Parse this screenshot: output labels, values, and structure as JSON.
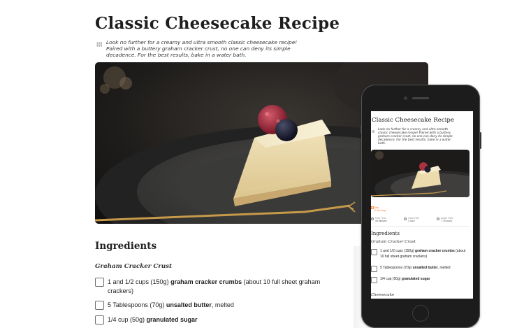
{
  "recipe": {
    "title": "Classic Cheesecake Recipe",
    "intro": "Look no further for a creamy and ultra smooth classic cheesecake recipe! Paired with a buttery graham cracker crust, no one can deny its simple decadence. For the best results, bake in a water bath.",
    "hero_image": "cheesecake-slice-with-raspberry-and-blackberry-on-plate",
    "ingredients_heading": "Ingredients",
    "crust_heading": "Graham Cracker Crust",
    "ingredients": [
      {
        "pre": "1 and 1/2 cups (150g) ",
        "bold": "graham cracker crumbs",
        "post": " (about 10 full sheet graham crackers)"
      },
      {
        "pre": "5 Tablespoons (70g) ",
        "bold": "unsalted butter",
        "post": ", melted"
      },
      {
        "pre": "1/4 cup (50g) ",
        "bold": "granulated sugar",
        "post": ""
      }
    ]
  },
  "mobile": {
    "title": "Classic Cheesecake Recipe",
    "intro": "Look no further for a creamy and ultra smooth classic cheesecake recipe! Paired with a buttery graham cracker crust, no one can deny its simple decadence. For the best results, bake in a water bath.",
    "yield": {
      "label": "Yield",
      "value": "12 servings"
    },
    "meta": [
      {
        "label": "Prep Time",
        "value": "45 minutes"
      },
      {
        "label": "Cook Time",
        "value": "1 hour"
      },
      {
        "label": "Active Time",
        "value": "7.75 hours"
      }
    ],
    "ingredients_heading": "Ingredients",
    "crust_heading": "Graham Cracker Crust",
    "ingredients": [
      {
        "pre": "1 and 1/2 cups (150g) ",
        "bold": "graham cracker crumbs",
        "post": " (about 10 full sheet graham crackers)"
      },
      {
        "pre": "5 Tablespoons (70g) ",
        "bold": "unsalted butter",
        "post": ", melted"
      },
      {
        "pre": "1/4 cup (50g) ",
        "bold": "granulated sugar",
        "post": ""
      }
    ],
    "next_heading": "Cheesecake"
  },
  "colors": {
    "accent": "#ff8a3d",
    "text": "#222222",
    "checkbox_border": "#6e6e6e"
  }
}
